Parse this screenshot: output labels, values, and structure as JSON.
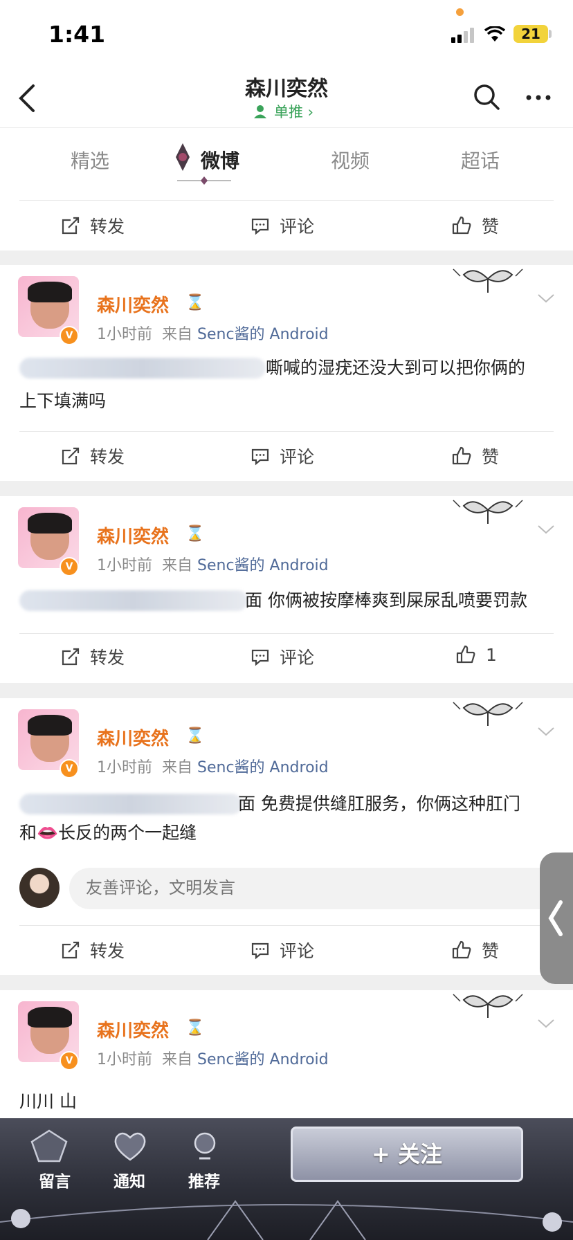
{
  "status_bar": {
    "time": "1:41",
    "battery": "21"
  },
  "header": {
    "title": "森川奕然",
    "subtitle": "单推 ›"
  },
  "tabs": [
    {
      "label": "精选"
    },
    {
      "label": "微博"
    },
    {
      "label": "视频"
    },
    {
      "label": "超话"
    }
  ],
  "actions": {
    "repost": "转发",
    "comment": "评论",
    "like": "赞"
  },
  "posts": [
    {
      "author": "森川奕然",
      "time": "1小时前",
      "from": "来自",
      "source": "Senc酱的 Android",
      "text_line1": "嘶喊的湿疣还没大到可以把你俩的",
      "text_line2": "上下填满吗",
      "likes": "赞"
    },
    {
      "author": "森川奕然",
      "time": "1小时前",
      "from": "来自",
      "source": "Senc酱的 Android",
      "text_line1": "面 你俩被按摩棒爽到屎尿乱喷要罚款",
      "likes": "1"
    },
    {
      "author": "森川奕然",
      "time": "1小时前",
      "from": "来自",
      "source": "Senc酱的 Android",
      "text_line1": "面 免费提供缝肛服务，你俩这种肛门",
      "text_line2": "和👄长反的两个一起缝",
      "likes": "赞"
    },
    {
      "author": "森川奕然",
      "time": "1小时前",
      "from": "来自",
      "source": "Senc酱的 Android",
      "text_line1": "川川 山"
    }
  ],
  "comment_box": {
    "placeholder": "友善评论，文明发言"
  },
  "bottom_bar": {
    "messages": "留言",
    "notifications": "通知",
    "recommend": "推荐",
    "follow": "+ 关注"
  },
  "colors": {
    "author": "#e8731d",
    "source": "#506a98",
    "verified": "#f7901e"
  }
}
